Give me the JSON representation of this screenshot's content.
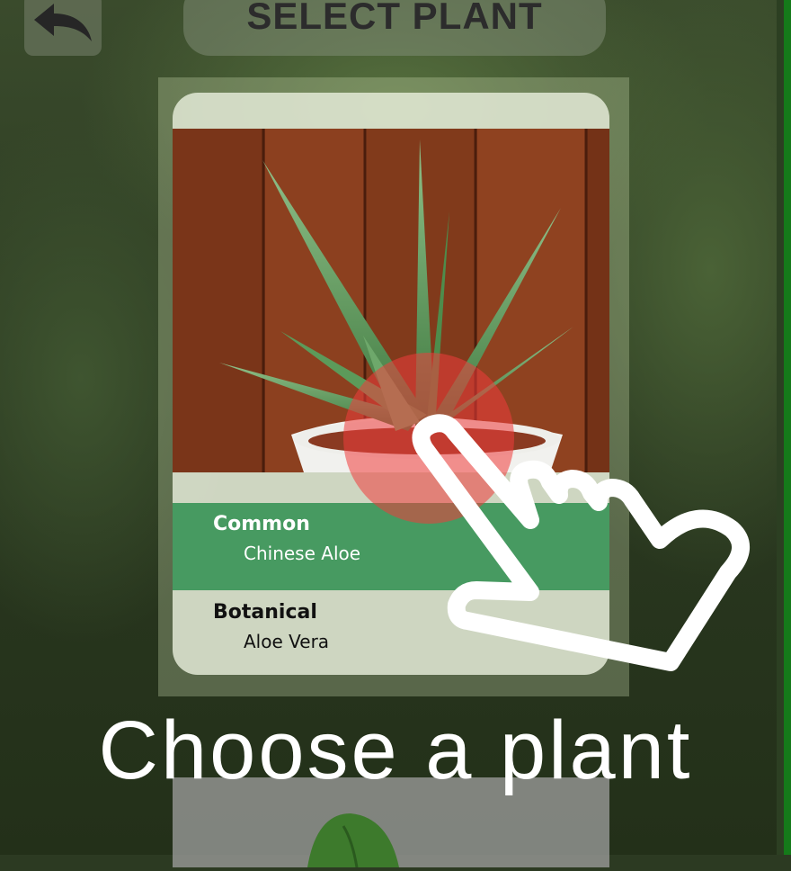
{
  "header": {
    "title": "SELECT PLANT",
    "back_icon": "back-arrow-icon"
  },
  "card": {
    "image": "aloe-plant-photo",
    "common_heading": "Common",
    "common_value": "Chinese Aloe",
    "botanical_heading": "Botanical",
    "botanical_value": "Aloe Vera"
  },
  "hint": {
    "caption": "Choose a plant",
    "hand_icon": "pointing-hand-icon",
    "tap_color": "#f03c3c"
  },
  "colors": {
    "accent_green": "#2f8f50",
    "edge_green": "#157a1a"
  }
}
